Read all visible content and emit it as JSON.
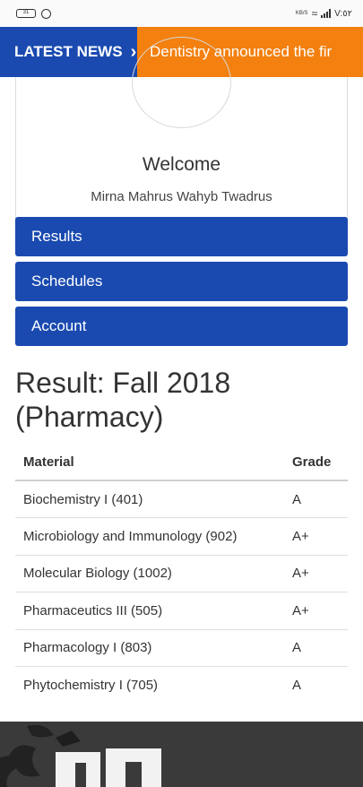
{
  "status_bar": {
    "battery": "31",
    "speed": "KB/S",
    "time": "V:٥٢"
  },
  "news": {
    "label": "LATEST NEWS",
    "ticker": "Dentistry announced the fir"
  },
  "profile": {
    "welcome": "Welcome",
    "name": "Mirna Mahrus Wahyb Twadrus"
  },
  "menu": {
    "items": [
      "Results",
      "Schedules",
      "Account"
    ]
  },
  "result": {
    "title_line1": "Result: Fall 2018",
    "title_line2": "(Pharmacy)",
    "headers": {
      "material": "Material",
      "grade": "Grade"
    },
    "rows": [
      {
        "material": "Biochemistry I (401)",
        "grade": "A"
      },
      {
        "material": "Microbiology and Immunology (902)",
        "grade": "A+"
      },
      {
        "material": "Molecular Biology (1002)",
        "grade": "A+"
      },
      {
        "material": "Pharmaceutics III (505)",
        "grade": "A+"
      },
      {
        "material": "Pharmacology I (803)",
        "grade": "A"
      },
      {
        "material": "Phytochemistry I (705)",
        "grade": "A"
      }
    ]
  },
  "colors": {
    "primary_blue": "#1a4ab0",
    "news_orange": "#f3800f",
    "footer_dark": "#3a3a3a"
  }
}
